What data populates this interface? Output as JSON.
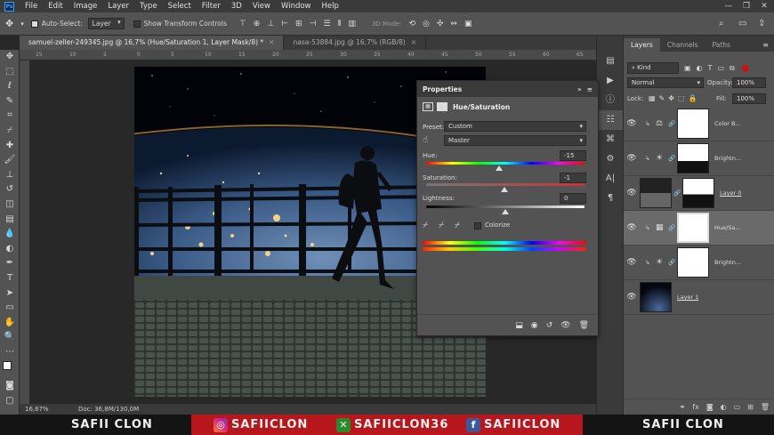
{
  "menu": {
    "logo": "Ps",
    "items": [
      "File",
      "Edit",
      "Image",
      "Layer",
      "Type",
      "Select",
      "Filter",
      "3D",
      "View",
      "Window",
      "Help"
    ],
    "controls": [
      "—",
      "❐",
      "✕"
    ]
  },
  "options": {
    "auto_select_label": "Auto-Select:",
    "auto_select_value": "Layer",
    "show_transform_label": "Show Transform Controls",
    "mode_3d_label": "3D Mode:"
  },
  "tabs": [
    {
      "label": "samuel-zeller-249345.jpg @ 16,7% (Hue/Saturation 1, Layer Mask/8) *"
    },
    {
      "label": "nasa-53884.jpg @ 16,7% (RGB/8)"
    }
  ],
  "ruler": {
    "top_ticks": [
      "15",
      "10",
      "5",
      "0",
      "5",
      "10",
      "15",
      "20",
      "25",
      "30",
      "35",
      "40",
      "45",
      "50",
      "55",
      "60",
      "65"
    ]
  },
  "status": {
    "zoom": "16,67%",
    "doc": "Doc: 36,8M/130,0M"
  },
  "properties": {
    "title": "Properties",
    "panel_name": "Hue/Saturation",
    "preset_label": "Preset:",
    "preset_value": "Custom",
    "channel_value": "Master",
    "hue_label": "Hue:",
    "hue_value": "-15",
    "saturation_label": "Saturation:",
    "saturation_value": "-1",
    "lightness_label": "Lightness:",
    "lightness_value": "0",
    "colorize_label": "Colorize",
    "hue_level": 0.458,
    "saturation_level": 0.495,
    "lightness_level": 0.5
  },
  "layers": {
    "tabs": [
      "Layers",
      "Channels",
      "Paths"
    ],
    "kind_label": "Kind",
    "blend_mode": "Normal",
    "opacity_label": "Opacity:",
    "opacity_value": "100%",
    "lock_label": "Lock:",
    "fill_label": "Fill:",
    "fill_value": "100%",
    "rows": [
      {
        "name": "Color B...",
        "type": "adjustment"
      },
      {
        "name": "Brightn...",
        "type": "adjustment"
      },
      {
        "name": "Layer 0",
        "type": "pixel"
      },
      {
        "name": "Hue/Sa...",
        "type": "adjustment",
        "selected": true
      },
      {
        "name": "Brightn...",
        "type": "adjustment"
      },
      {
        "name": "Layer 1",
        "type": "pixel"
      }
    ]
  },
  "banner": {
    "left_name": "SAFII CLON",
    "instagram": "SAFIICLON",
    "xbox": "SAFIICLON36",
    "facebook": "SAFIICLON",
    "right_name": "SAFII CLON",
    "accent": "#b7161d"
  }
}
